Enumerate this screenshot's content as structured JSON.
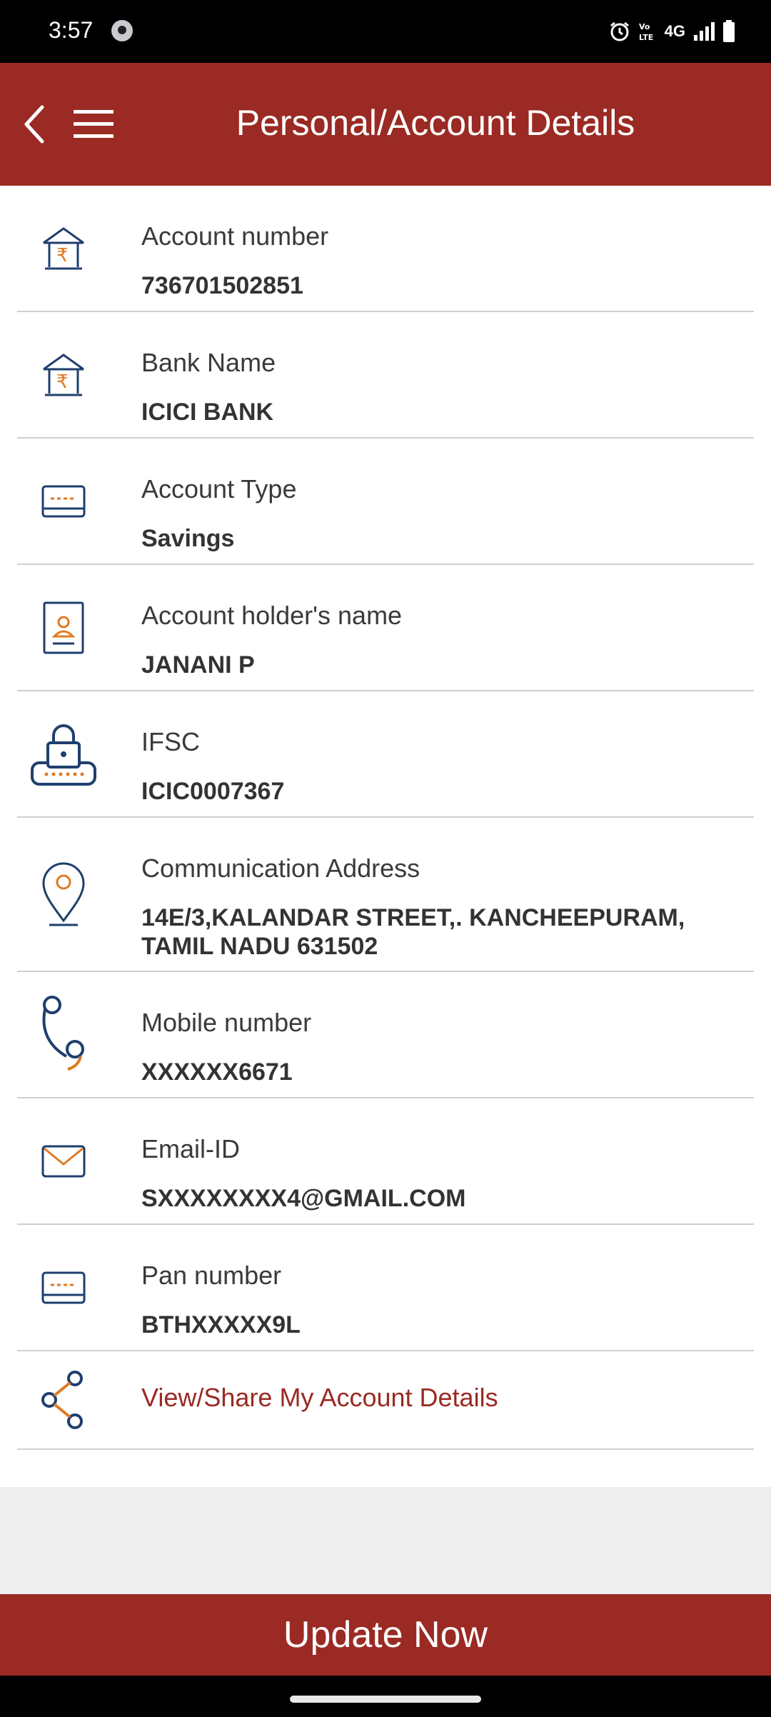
{
  "status_bar": {
    "time": "3:57",
    "network": "4G",
    "icons": [
      "app-icon",
      "alarm-icon",
      "volte-icon",
      "signal-icon",
      "battery-icon"
    ]
  },
  "header": {
    "title": "Personal/Account Details",
    "back_icon": "chevron-left-icon",
    "menu_icon": "hamburger-menu-icon"
  },
  "details": [
    {
      "label": "Account number",
      "value": "736701502851",
      "icon": "bank-icon"
    },
    {
      "label": "Bank Name",
      "value": "ICICI BANK",
      "icon": "bank-icon"
    },
    {
      "label": "Account Type",
      "value": "Savings",
      "icon": "card-icon"
    },
    {
      "label": "Account holder's name",
      "value": "JANANI P",
      "icon": "id-badge-icon"
    },
    {
      "label": "IFSC",
      "value": "ICIC0007367",
      "icon": "lock-icon"
    },
    {
      "label": "Communication Address",
      "value_line1": "14E/3,KALANDAR STREET,. KANCHEEPURAM,",
      "value_line2": "TAMIL NADU 631502",
      "icon": "location-pin-icon"
    },
    {
      "label": "Mobile number",
      "value": "XXXXXX6671",
      "icon": "phone-icon"
    },
    {
      "label": "Email-ID",
      "value": "SXXXXXXXX4@GMAIL.COM",
      "icon": "envelope-icon"
    },
    {
      "label": "Pan number",
      "value": "BTHXXXXX9L",
      "icon": "card-icon"
    }
  ],
  "share_link": {
    "label": "View/Share My Account Details",
    "icon": "share-icon"
  },
  "update_button": {
    "label": "Update Now"
  },
  "colors": {
    "brand": "#9a2a23",
    "icon_blue": "#1f3f6e",
    "icon_orange": "#e07a22",
    "divider": "#cfcfcf"
  }
}
